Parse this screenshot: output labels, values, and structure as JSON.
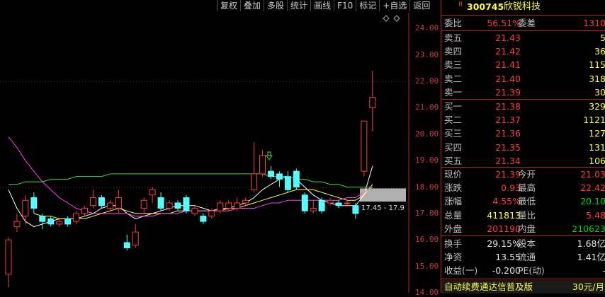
{
  "toolbar": [
    "复权",
    "叠加",
    "多股",
    "统计",
    "画线",
    "F10",
    "标记",
    "+自选",
    "返回"
  ],
  "stock": {
    "flag": "R",
    "code": "300745",
    "name": "欣锐科技"
  },
  "ratio": {
    "label": "委比",
    "value": "56.51%",
    "label2": "委差",
    "value2": "1310"
  },
  "sell": [
    {
      "label": "卖五",
      "price": "21.43",
      "vol": "5"
    },
    {
      "label": "卖四",
      "price": "21.42",
      "vol": "36"
    },
    {
      "label": "卖三",
      "price": "21.41",
      "vol": "115"
    },
    {
      "label": "卖二",
      "price": "21.40",
      "vol": "318"
    },
    {
      "label": "卖一",
      "price": "21.39",
      "vol": "30"
    }
  ],
  "buy": [
    {
      "label": "买一",
      "price": "21.38",
      "vol": "329"
    },
    {
      "label": "买二",
      "price": "21.37",
      "vol": "1121"
    },
    {
      "label": "买三",
      "price": "21.36",
      "vol": "127"
    },
    {
      "label": "买四",
      "price": "21.35",
      "vol": "131"
    },
    {
      "label": "买五",
      "price": "21.34",
      "vol": "106"
    }
  ],
  "quote": [
    {
      "l1": "现价",
      "v1": "21.39",
      "c1": "red",
      "l2": "今开",
      "v2": "21.03",
      "c2": "red"
    },
    {
      "l1": "涨跌",
      "v1": "0.93",
      "c1": "red",
      "l2": "最高",
      "v2": "22.42",
      "c2": "red"
    },
    {
      "l1": "涨幅",
      "v1": "4.55%",
      "c1": "red",
      "l2": "最低",
      "v2": "20.10",
      "c2": "green"
    },
    {
      "l1": "总量",
      "v1": "411813",
      "c1": "yellow",
      "l2": "量比",
      "v2": "5.48",
      "c2": "red"
    },
    {
      "l1": "外盘",
      "v1": "201190",
      "c1": "red",
      "l2": "内盘",
      "v2": "210623",
      "c2": "green"
    }
  ],
  "fundamentals": [
    {
      "l1": "换手",
      "v1": "29.15%",
      "l2": "股本",
      "v2": "1.68亿"
    },
    {
      "l1": "净资",
      "v1": "13.55",
      "l2": "流通",
      "v2": "1.41亿"
    },
    {
      "l1": "收益(一)",
      "v1": "-0.200",
      "l2": "PE(动)",
      "v2": "-"
    }
  ],
  "footer": {
    "text": "自动续费通达信普及版",
    "price": "30元/月"
  },
  "chart_label": "17.45 - 17.9",
  "chart_data": {
    "type": "candlestick",
    "y_ticks": [
      "24.00",
      "23.00",
      "22.00",
      "21.00",
      "20.00",
      "19.00",
      "18.00",
      "17.00",
      "16.00",
      "15.00",
      "14.00"
    ],
    "ylim": [
      14.0,
      24.6
    ],
    "candles": [
      {
        "o": 14.7,
        "c": 16.0,
        "h": 16.1,
        "l": 14.2
      },
      {
        "o": 16.5,
        "c": 16.7,
        "h": 17.0,
        "l": 16.3
      },
      {
        "o": 16.9,
        "c": 17.5,
        "h": 17.7,
        "l": 16.6
      },
      {
        "o": 17.6,
        "c": 17.2,
        "h": 17.8,
        "l": 17.0
      },
      {
        "o": 16.9,
        "c": 16.7,
        "h": 17.0,
        "l": 16.4
      },
      {
        "o": 16.8,
        "c": 16.6,
        "h": 16.9,
        "l": 16.5
      },
      {
        "o": 16.6,
        "c": 16.7,
        "h": 16.8,
        "l": 16.5
      },
      {
        "o": 16.8,
        "c": 16.6,
        "h": 16.9,
        "l": 16.5
      },
      {
        "o": 16.7,
        "c": 17.0,
        "h": 17.1,
        "l": 16.6
      },
      {
        "o": 17.0,
        "c": 17.2,
        "h": 17.3,
        "l": 16.9
      },
      {
        "o": 17.3,
        "c": 17.6,
        "h": 17.9,
        "l": 17.2
      },
      {
        "o": 17.6,
        "c": 17.3,
        "h": 17.7,
        "l": 17.2
      },
      {
        "o": 17.2,
        "c": 17.4,
        "h": 17.5,
        "l": 17.1
      },
      {
        "o": 17.2,
        "c": 17.6,
        "h": 17.9,
        "l": 17.0
      },
      {
        "o": 15.9,
        "c": 15.7,
        "h": 16.2,
        "l": 15.6
      },
      {
        "o": 15.8,
        "c": 16.3,
        "h": 16.6,
        "l": 15.7
      },
      {
        "o": 17.2,
        "c": 17.5,
        "h": 17.6,
        "l": 17.0
      },
      {
        "o": 17.7,
        "c": 17.9,
        "h": 18.0,
        "l": 17.4
      },
      {
        "o": 17.6,
        "c": 17.2,
        "h": 17.8,
        "l": 17.1
      },
      {
        "o": 17.2,
        "c": 17.4,
        "h": 17.5,
        "l": 17.1
      },
      {
        "o": 17.4,
        "c": 17.2,
        "h": 17.5,
        "l": 17.1
      },
      {
        "o": 17.6,
        "c": 17.1,
        "h": 17.7,
        "l": 17.0
      },
      {
        "o": 17.0,
        "c": 17.2,
        "h": 17.3,
        "l": 16.9
      },
      {
        "o": 16.9,
        "c": 16.7,
        "h": 17.0,
        "l": 16.6
      },
      {
        "o": 16.9,
        "c": 17.1,
        "h": 17.2,
        "l": 16.8
      },
      {
        "o": 17.1,
        "c": 17.4,
        "h": 17.5,
        "l": 17.0
      },
      {
        "o": 17.2,
        "c": 17.4,
        "h": 17.5,
        "l": 17.1
      },
      {
        "o": 17.2,
        "c": 17.4,
        "h": 17.6,
        "l": 17.1
      },
      {
        "o": 17.4,
        "c": 17.5,
        "h": 17.6,
        "l": 17.3
      },
      {
        "o": 17.9,
        "c": 18.5,
        "h": 19.7,
        "l": 17.8
      },
      {
        "o": 18.5,
        "c": 19.2,
        "h": 19.4,
        "l": 18.4
      },
      {
        "o": 18.6,
        "c": 18.4,
        "h": 18.8,
        "l": 18.3
      },
      {
        "o": 18.5,
        "c": 18.3,
        "h": 18.6,
        "l": 18.0
      },
      {
        "o": 18.4,
        "c": 17.9,
        "h": 18.6,
        "l": 17.8
      },
      {
        "o": 18.6,
        "c": 18.0,
        "h": 18.7,
        "l": 17.9
      },
      {
        "o": 17.7,
        "c": 17.1,
        "h": 17.8,
        "l": 17.0
      },
      {
        "o": 17.1,
        "c": 17.2,
        "h": 17.5,
        "l": 17.0
      },
      {
        "o": 17.5,
        "c": 17.1,
        "h": 17.6,
        "l": 17.0
      },
      {
        "o": 17.4,
        "c": 17.5,
        "h": 17.6,
        "l": 17.3
      },
      {
        "o": 17.4,
        "c": 17.3,
        "h": 17.5,
        "l": 17.2
      },
      {
        "o": 17.4,
        "c": 17.4,
        "h": 17.5,
        "l": 17.3
      },
      {
        "o": 17.3,
        "c": 17.0,
        "h": 17.4,
        "l": 16.8
      },
      {
        "o": 18.6,
        "c": 20.5,
        "h": 20.5,
        "l": 18.4
      },
      {
        "o": 21.0,
        "c": 21.4,
        "h": 22.4,
        "l": 20.1
      }
    ],
    "ma": [
      {
        "color": "#ffffff",
        "values": [
          17.9,
          17.2,
          16.7,
          16.5,
          16.6,
          16.7,
          16.8,
          16.8,
          16.8,
          16.9,
          17.0,
          17.2,
          17.3,
          17.3,
          17.0,
          16.8,
          16.9,
          17.0,
          17.1,
          17.2,
          17.3,
          17.3,
          17.3,
          17.2,
          17.1,
          17.2,
          17.2,
          17.3,
          17.4,
          17.6,
          17.9,
          18.1,
          18.3,
          18.4,
          18.3,
          18.0,
          17.7,
          17.5,
          17.4,
          17.3,
          17.3,
          17.3,
          17.7,
          18.8
        ]
      },
      {
        "color": "#ffff40",
        "values": [
          null,
          null,
          null,
          17.0,
          16.9,
          16.9,
          16.8,
          16.8,
          16.8,
          16.8,
          16.9,
          17.0,
          17.1,
          17.2,
          17.1,
          17.0,
          17.0,
          17.0,
          17.0,
          17.0,
          17.1,
          17.1,
          17.1,
          17.1,
          17.1,
          17.1,
          17.2,
          17.2,
          17.3,
          17.4,
          17.5,
          17.6,
          17.7,
          17.8,
          17.9,
          17.9,
          17.9,
          17.8,
          17.7,
          17.6,
          17.5,
          17.5,
          17.7,
          18.1
        ]
      },
      {
        "color": "#ff40ff",
        "values": [
          19.9,
          19.5,
          19.0,
          18.6,
          18.2,
          17.9,
          17.6,
          17.4,
          17.2,
          17.1,
          17.0,
          17.0,
          17.0,
          17.0,
          17.0,
          16.9,
          16.9,
          16.9,
          17.0,
          17.0,
          17.0,
          17.1,
          17.1,
          17.1,
          17.1,
          17.1,
          17.1,
          17.2,
          17.2,
          17.2,
          17.3,
          17.4,
          17.4,
          17.5,
          17.5,
          17.5,
          17.5,
          17.5,
          17.5,
          17.5,
          17.6,
          17.6,
          17.8,
          18.0
        ]
      },
      {
        "color": "#40d840",
        "values": [
          18.1,
          18.1,
          18.2,
          18.2,
          18.2,
          18.3,
          18.3,
          18.3,
          18.4,
          18.4,
          18.4,
          18.4,
          18.5,
          18.5,
          18.5,
          18.5,
          18.5,
          18.5,
          18.5,
          18.5,
          18.5,
          18.5,
          18.5,
          18.5,
          18.5,
          18.5,
          18.5,
          18.5,
          18.5,
          18.5,
          18.5,
          18.4,
          18.4,
          18.4,
          18.3,
          18.3,
          18.2,
          18.2,
          18.1,
          18.1,
          18.0,
          18.0,
          18.0,
          18.0
        ]
      }
    ]
  }
}
